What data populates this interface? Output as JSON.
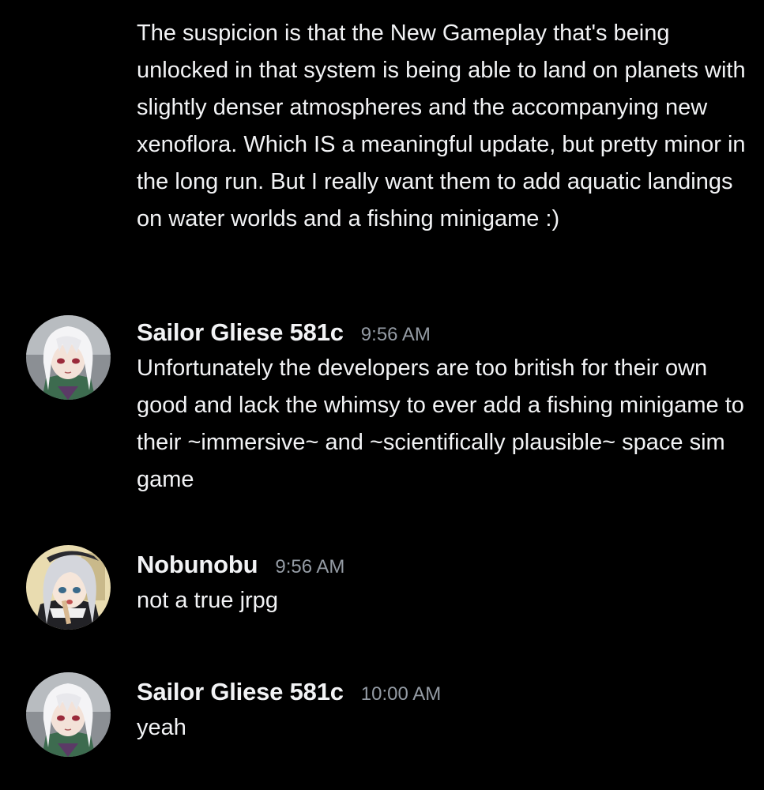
{
  "colors": {
    "background": "#000000",
    "text": "#f2f3f5",
    "timestamp": "#949ba4"
  },
  "messages": [
    {
      "text": "The suspicion is that the New Gameplay that's being unlocked in that system is being able to land on planets with slightly denser atmospheres and the accompanying new xenoflora. Which IS a meaningful update, but pretty minor in the long run. But I really want them to add aquatic landings on water worlds and a fishing minigame :)"
    },
    {
      "username": "Sailor Gliese 581c",
      "timestamp": "9:56 AM",
      "avatar": "white-haired-anime-avatar",
      "text": "Unfortunately the developers are too british for their own good and lack the whimsy to ever add a fishing minigame to their ~immersive~ and ~scientifically plausible~ space sim game"
    },
    {
      "username": "Nobunobu",
      "timestamp": "9:56 AM",
      "avatar": "silver-haired-anime-avatar",
      "text": "not a true jrpg"
    },
    {
      "username": "Sailor Gliese 581c",
      "timestamp": "10:00 AM",
      "avatar": "white-haired-anime-avatar",
      "text": "yeah"
    }
  ]
}
